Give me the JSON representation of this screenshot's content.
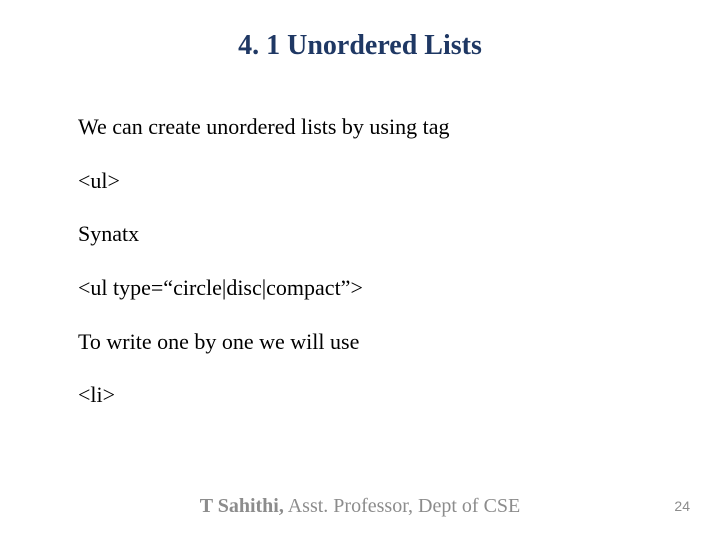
{
  "title": "4. 1 Unordered Lists",
  "body": {
    "p1": "We can  create unordered lists by using tag",
    "p2": "<ul>",
    "p3": "Synatx",
    "p4": "<ul type=“circle|disc|compact”>",
    "p5": "To write one by one we will use",
    "p6": "<li>"
  },
  "footer": {
    "name": "T Sahithi,",
    "rest": " Asst. Professor, Dept of CSE"
  },
  "page_number": "24"
}
